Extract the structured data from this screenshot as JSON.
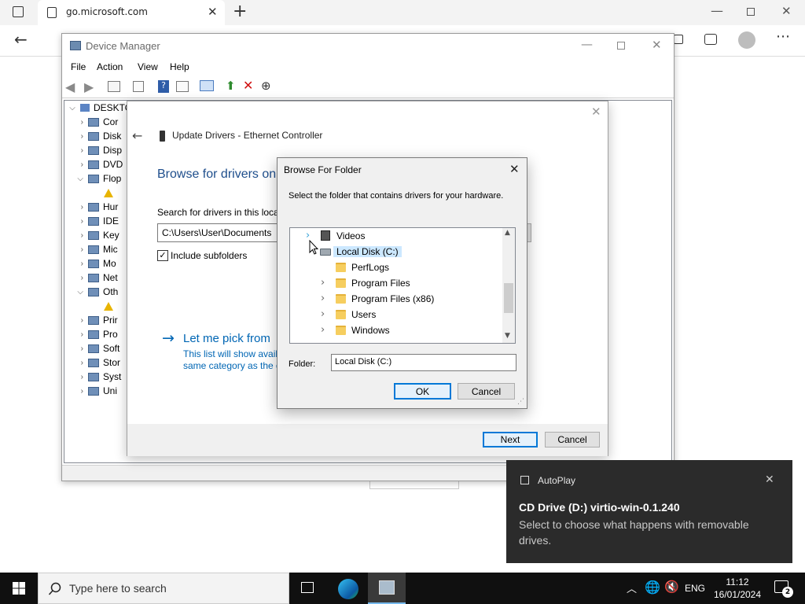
{
  "browser": {
    "tab_title": "go.microsoft.com"
  },
  "device_manager": {
    "title": "Device Manager",
    "menu": [
      "File",
      "Action",
      "View",
      "Help"
    ],
    "tree_root": "DESKTO",
    "tree_items": [
      "Cor",
      "Disk",
      "Disp",
      "DVD",
      "Flop",
      "",
      "Hur",
      "IDE",
      "Key",
      "Mic",
      "Mo",
      "Net",
      "Oth",
      "",
      "Prir",
      "Pro",
      "Soft",
      "Stor",
      "Syst",
      "Uni"
    ]
  },
  "update_drivers": {
    "title": "Update Drivers - Ethernet Controller",
    "heading": "Browse for drivers on",
    "search_label": "Search for drivers in this loca",
    "path_value": "C:\\Users\\User\\Documents",
    "include_subfolders": "Include subfolders",
    "pick_title": "Let me pick from",
    "pick_desc_1": "This list will show avail",
    "pick_desc_2": "same category as the d",
    "next_label": "Next",
    "cancel_label": "Cancel"
  },
  "browse_folder": {
    "title": "Browse For Folder",
    "instruction": "Select the folder that contains drivers for your hardware.",
    "tree": [
      {
        "label": "Videos",
        "level": 0,
        "icon": "film-icon",
        "expandable": true
      },
      {
        "label": "Local Disk (C:)",
        "level": 0,
        "icon": "drive-icon",
        "expandable": false,
        "selected": true
      },
      {
        "label": "PerfLogs",
        "level": 1,
        "icon": "folder-icon",
        "expandable": false
      },
      {
        "label": "Program Files",
        "level": 1,
        "icon": "folder-icon",
        "expandable": true
      },
      {
        "label": "Program Files (x86)",
        "level": 1,
        "icon": "folder-icon",
        "expandable": true
      },
      {
        "label": "Users",
        "level": 1,
        "icon": "folder-icon",
        "expandable": true
      },
      {
        "label": "Windows",
        "level": 1,
        "icon": "folder-icon",
        "expandable": true
      }
    ],
    "folder_label": "Folder:",
    "folder_value": "Local Disk (C:)",
    "ok_label": "OK",
    "cancel_label": "Cancel"
  },
  "toast": {
    "app": "AutoPlay",
    "title": "CD Drive (D:) virtio-win-0.1.240",
    "body": "Select to choose what happens with removable drives."
  },
  "taskbar": {
    "search_placeholder": "Type here to search",
    "lang": "ENG",
    "time": "11:12",
    "date": "16/01/2024",
    "notifications": "2"
  },
  "colors": {
    "accent": "#0078d7",
    "link": "#0066b4",
    "selection": "#cce8ff"
  }
}
